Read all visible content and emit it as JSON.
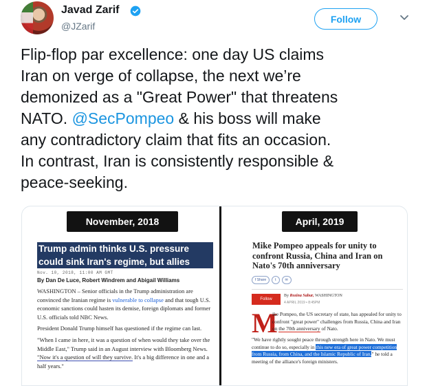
{
  "user": {
    "name": "Javad Zarif",
    "handle": "@JZarif"
  },
  "follow_label": "Follow",
  "tweet": {
    "lines": [
      "Flip-flop par excellence: one day US claims",
      "Iran on verge of collapse, the next we’re",
      "demonized as a \"Great Power\" that threatens",
      "NATO.",
      "& his boss will make",
      "any contradictory claim that fits an occasion.",
      "In contrast, Iran is consistently responsible &",
      "peace-seeking."
    ],
    "mention": "@SecPompeo"
  },
  "media": {
    "left": {
      "date_label": "November, 2018",
      "headline": "Trump admin thinks U.S. pressure could sink Iran's regime, but allies have doubts",
      "meta_date": "Nov. 10, 2018, 11:00 AM GMT",
      "byline": "By Dan De Luce, Robert Windrem and Abigail Williams",
      "p1_a": "WASHINGTON – Senior officials in the Trump administration are convinced the Iranian regime is",
      "p1_link": "vulnerable to collapse",
      "p1_b": "and that tough U.S. economic sanctions could hasten its demise, foreign diplomats and former U.S. officials told NBC News.",
      "p2": "President Donald Trump himself has questioned if the regime can last.",
      "p3_a": "\"When I came in here, it was a question of when would they take over the Middle East,\" Trump said in an August interview with Bloomberg News.",
      "p3_u": "\"Now it's a question of will they survive.",
      "p3_b": "It's a big difference in one and a half years.\""
    },
    "right": {
      "date_label": "April, 2019",
      "headline": "Mike Pompeo appeals for unity to confront Russia, China and Iran on Nato's 70th anniversary",
      "share_buttons": [
        "f Share",
        "t",
        "✉"
      ],
      "follow_label": "Follow",
      "byline_prefix": "By",
      "byline_name": "Rozina Sabur,",
      "byline_suffix": "WASHINGTON",
      "byline_date": "4 APRIL 2019 • 8:45PM",
      "dropcap": "M",
      "p1_a": "ike Pompeo, the US secretary of state, has appealed for unity to confront \"great power\" challenges from Russia, China and Iran on",
      "p1_u": "the 70th anniversary",
      "p1_b": "of Nato.",
      "p2_a": "\"We have rightly sought peace through strength here in Nato. We must continue to do so, especially in",
      "p2_hl": "this new era of great power competition from Russia, from China, and the Islamic Republic of Iran,",
      "p2_b": "\" he told a meeting of the alliance's foreign ministers."
    }
  },
  "colors": {
    "twitter_blue": "#1da1f2",
    "mention": "#1b95e0",
    "headline_bg": "#233a63",
    "telegraph_red": "#d52b1e"
  }
}
